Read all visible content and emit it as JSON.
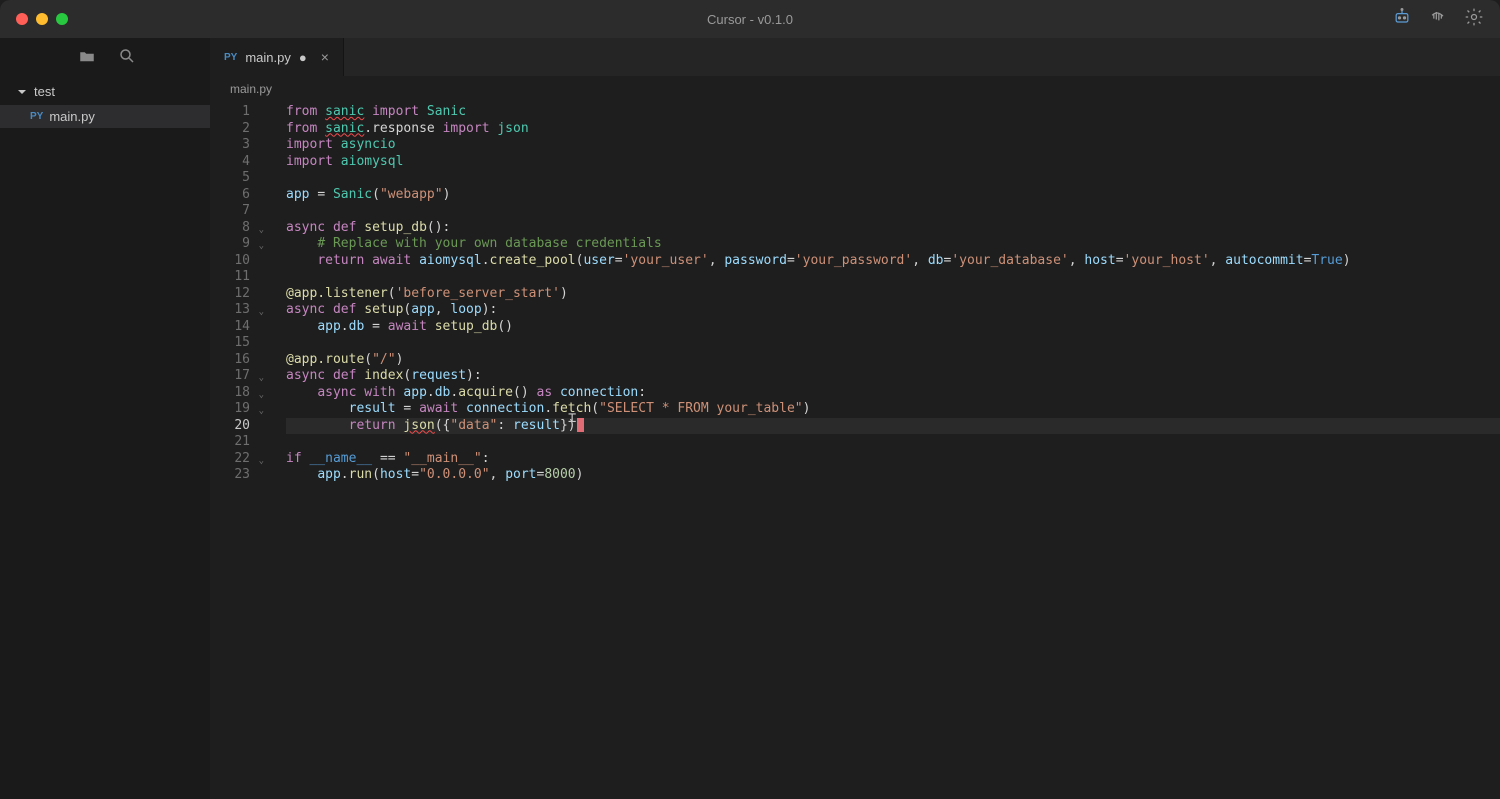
{
  "window": {
    "title": "Cursor - v0.1.0"
  },
  "sidebar": {
    "folder_name": "test",
    "files": [
      {
        "badge": "PY",
        "name": "main.py"
      }
    ]
  },
  "tabs": [
    {
      "badge": "PY",
      "label": "main.py",
      "dirty": "●"
    }
  ],
  "breadcrumb": "main.py",
  "editor": {
    "line_numbers": [
      "1",
      "2",
      "3",
      "4",
      "5",
      "6",
      "7",
      "8",
      "9",
      "10",
      "11",
      "12",
      "13",
      "14",
      "15",
      "16",
      "17",
      "18",
      "19",
      "20",
      "21",
      "22",
      "23"
    ],
    "current_line": 20,
    "foldable_lines": [
      8,
      9,
      13,
      17,
      18,
      19,
      22
    ],
    "code_plain": "from sanic import Sanic\nfrom sanic.response import json\nimport asyncio\nimport aiomysql\n\napp = Sanic(\"webapp\")\n\nasync def setup_db():\n    # Replace with your own database credentials\n    return await aiomysql.create_pool(user='your_user', password='your_password', db='your_database', host='your_host', autocommit=True)\n\n@app.listener('before_server_start')\nasync def setup(app, loop):\n    app.db = await setup_db()\n\n@app.route(\"/\")\nasync def index(request):\n    async with app.db.acquire() as connection:\n        result = await connection.fetch(\"SELECT * FROM your_table\")\n        return json({\"data\": result})\n\nif __name__ == \"__main__\":\n    app.run(host=\"0.0.0.0\", port=8000)"
  }
}
